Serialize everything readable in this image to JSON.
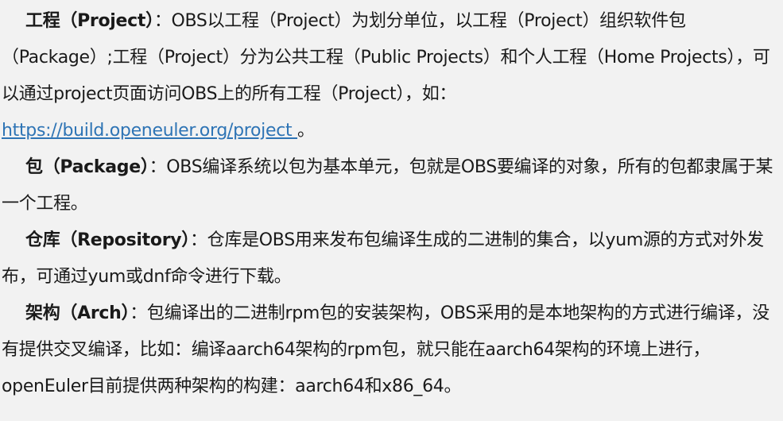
{
  "definitions": [
    {
      "term": "工程（Project）",
      "text": "：OBS以工程（Project）为划分单位，以工程（Project）组织软件包（Package）;工程（Project）分为公共工程（Public Projects）和个人工程（Home Projects），可以通过project页面访问OBS上的所有工程（Project），如：",
      "link": "https://build.openeuler.org/project ",
      "after_link": "。"
    },
    {
      "term": "包（Package）",
      "text": "：OBS编译系统以包为基本单元，包就是OBS要编译的对象，所有的包都隶属于某一个工程。"
    },
    {
      "term": "仓库（Repository）",
      "text": "：仓库是OBS用来发布包编译生成的二进制的集合，以yum源的方式对外发布，可通过yum或dnf命令进行下载。"
    },
    {
      "term": "架构（Arch）",
      "text": "：包编译出的二进制rpm包的安装架构，OBS采用的是本地架构的方式进行编译，没有提供交叉编译，比如：编译aarch64架构的rpm包，就只能在aarch64架构的环境上进行，openEuler目前提供两种架构的构建：aarch64和x86_64。"
    }
  ]
}
